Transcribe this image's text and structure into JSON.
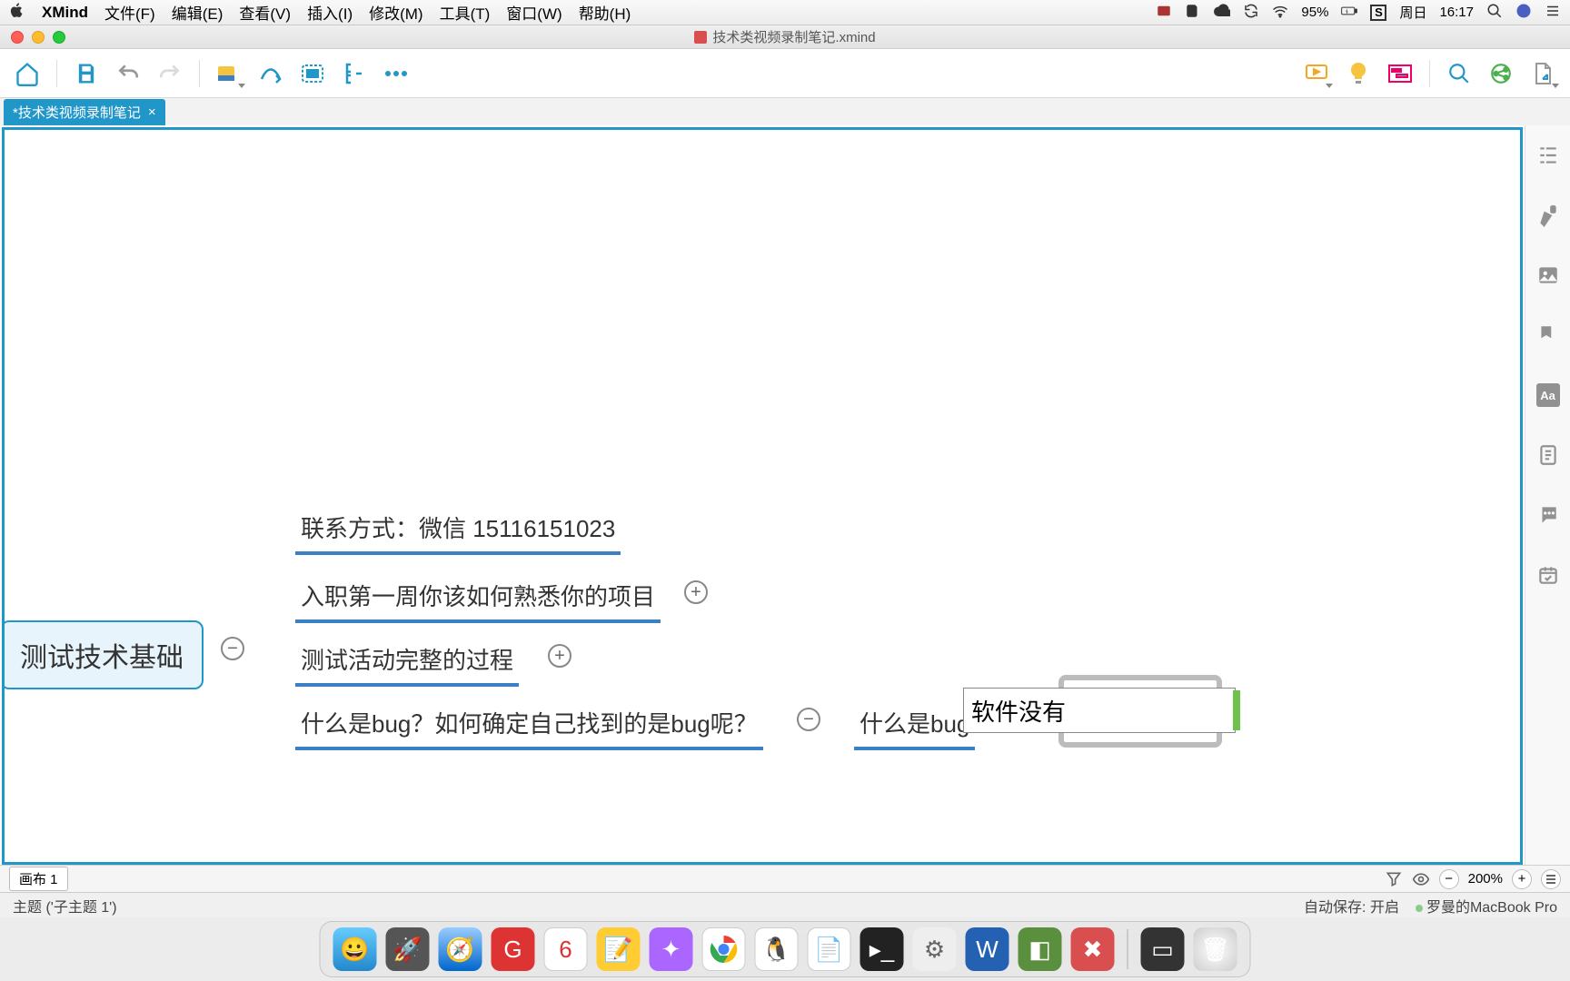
{
  "menubar": {
    "app": "XMind",
    "items": [
      "文件(F)",
      "编辑(E)",
      "查看(V)",
      "插入(I)",
      "修改(M)",
      "工具(T)",
      "窗口(W)",
      "帮助(H)"
    ],
    "battery": "95%",
    "day": "周日",
    "time": "16:17"
  },
  "window": {
    "title": "技术类视频录制笔记.xmind"
  },
  "tab": {
    "label": "*技术类视频录制笔记",
    "close": "×"
  },
  "mindmap": {
    "root": "测试技术基础",
    "b1": "联系方式：微信  15116151023",
    "b2": "入职第一周你该如何熟悉你的项目",
    "b3": "测试活动完整的过程",
    "b4": "什么是bug？如何确定自己找到的是bug呢？",
    "sub": "什么是bug",
    "editing": "软件没有",
    "plus": "+",
    "minus": "−"
  },
  "sheet": {
    "name": "画布 1"
  },
  "zoom": {
    "value": "200%",
    "plus": "+",
    "minus": "−"
  },
  "status": {
    "left": "主题 ('子主题 1')",
    "autosave_label": "自动保存:",
    "autosave_value": "开启",
    "machine": "罗曼的MacBook Pro"
  },
  "icons": {
    "home": "home-icon",
    "save": "save-icon",
    "undo": "undo-icon",
    "redo": "redo-icon",
    "topic": "topic-icon",
    "relation": "relation-icon",
    "boundary": "boundary-icon",
    "summary": "summary-icon",
    "more": "more-icon",
    "present": "present-icon",
    "idea": "idea-icon",
    "gantt": "gantt-icon",
    "search": "search-icon",
    "share": "share-icon",
    "export": "export-icon",
    "outline": "outline-icon",
    "format": "format-icon",
    "image": "image-icon",
    "marker": "marker-icon",
    "font": "font-icon",
    "notes": "notes-icon",
    "comments": "comments-icon",
    "task": "task-icon"
  }
}
